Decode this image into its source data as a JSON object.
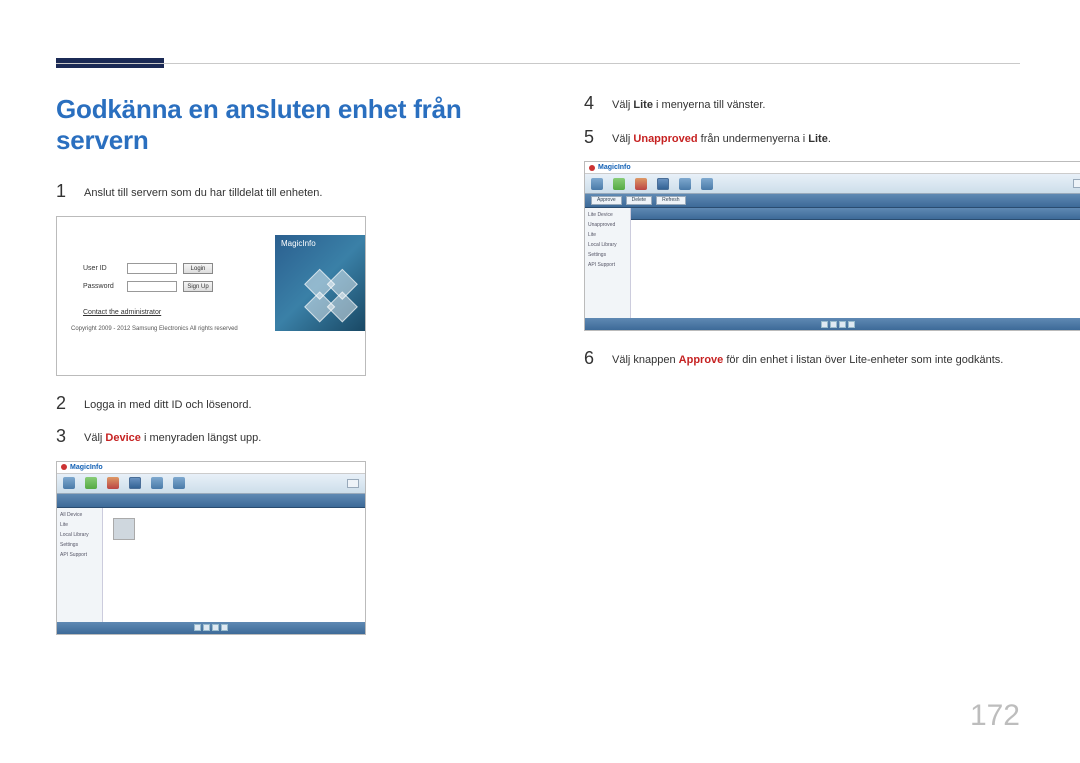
{
  "page_number": "172",
  "heading": "Godkänna en ansluten enhet från servern",
  "steps": {
    "s1": {
      "num": "1",
      "text": "Anslut till servern som du har tilldelat till enheten."
    },
    "s2": {
      "num": "2",
      "text": "Logga in med ditt ID och lösenord."
    },
    "s3": {
      "num": "3",
      "pre": "Välj ",
      "hl": "Device",
      "post": " i menyraden längst upp."
    },
    "s4": {
      "num": "4",
      "pre": "Välj ",
      "hl": "Lite",
      "post": " i menyerna till vänster."
    },
    "s5": {
      "num": "5",
      "pre": "Välj ",
      "hl": "Unapproved",
      "post_pre": " från undermenyerna i ",
      "post_hl": "Lite",
      "post_end": "."
    },
    "s6": {
      "num": "6",
      "pre": "Välj knappen ",
      "hl": "Approve",
      "post": " för din enhet i listan över Lite-enheter som inte godkänts."
    }
  },
  "login_shot": {
    "brand": "MagicInfo",
    "user_label": "User ID",
    "pass_label": "Password",
    "login_btn": "Login",
    "signup_btn": "Sign Up",
    "contact": "Contact the administrator",
    "copyright": "Copyright 2009 - 2012 Samsung Electronics All rights reserved"
  },
  "app_shot": {
    "brand": "MagicInfo",
    "sidebar": [
      "All Device",
      "Lite",
      "Local Library",
      "Settings",
      "API Support"
    ]
  },
  "app_shot2": {
    "brand": "MagicInfo",
    "sidebar": [
      "Lite Device",
      "Unapproved",
      "Lite",
      "Local Library",
      "Settings",
      "API Support"
    ],
    "btn_approve": "Approve",
    "btn_delete": "Delete",
    "btn_refresh": "Refresh"
  }
}
